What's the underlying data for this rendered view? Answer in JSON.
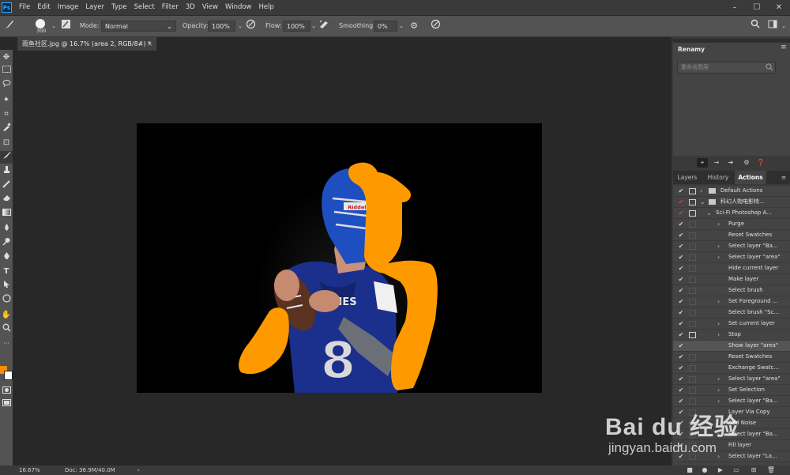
{
  "menubar": {
    "logo": "Ps",
    "items": [
      "File",
      "Edit",
      "Image",
      "Layer",
      "Type",
      "Select",
      "Filter",
      "3D",
      "View",
      "Window",
      "Help"
    ],
    "window_buttons": [
      "–",
      "☐",
      "✕"
    ]
  },
  "options": {
    "brush_size": "300",
    "mode_label": "Mode:",
    "mode_value": "Normal",
    "opacity_label": "Opacity:",
    "opacity_value": "100%",
    "flow_label": "Flow:",
    "flow_value": "100%",
    "smoothing_label": "Smoothing:",
    "smoothing_value": "0%"
  },
  "document": {
    "tab_title": "雨鱼社区.jpg @ 16.7% (area 2, RGB/8#) *",
    "tab_close": "×"
  },
  "status": {
    "zoom": "16.67%",
    "doc": "Doc: 36.9M/40.0M",
    "arrow": "›"
  },
  "colors": {
    "foreground": "#ff8c00",
    "background": "#ffffff",
    "paint": "#ff9900"
  },
  "renamy": {
    "title": "Renamy",
    "search_placeholder": "重命名图层"
  },
  "panel_tabs": {
    "layers": "Layers",
    "history": "History",
    "actions": "Actions"
  },
  "actions": [
    {
      "label": "Default Actions",
      "level": 0,
      "check": "✔",
      "red": false,
      "folder": true,
      "arrow": "›"
    },
    {
      "label": "科幻人物电影特...",
      "level": 0,
      "check": "✔",
      "red": true,
      "folder": true,
      "arrow": "⌄"
    },
    {
      "label": "Sci-Fi Photoshop A...",
      "level": 1,
      "check": "✔",
      "red": true,
      "folder": false,
      "arrow": "⌄"
    },
    {
      "label": "Purge",
      "level": 2,
      "check": "✔",
      "red": false,
      "folder": false,
      "arrow": "›"
    },
    {
      "label": "Reset Swatches",
      "level": 2,
      "check": "✔",
      "red": false,
      "folder": false,
      "arrow": ""
    },
    {
      "label": "Select layer \"Ba...",
      "level": 2,
      "check": "✔",
      "red": false,
      "folder": false,
      "arrow": "›"
    },
    {
      "label": "Select layer \"area\"",
      "level": 2,
      "check": "✔",
      "red": false,
      "folder": false,
      "arrow": "›"
    },
    {
      "label": "Hide current layer",
      "level": 2,
      "check": "✔",
      "red": false,
      "folder": false,
      "arrow": ""
    },
    {
      "label": "Make layer",
      "level": 2,
      "check": "✔",
      "red": false,
      "folder": false,
      "arrow": ""
    },
    {
      "label": "Select brush",
      "level": 2,
      "check": "✔",
      "red": false,
      "folder": false,
      "arrow": ""
    },
    {
      "label": "Set Foreground ...",
      "level": 2,
      "check": "✔",
      "red": false,
      "folder": false,
      "arrow": "›"
    },
    {
      "label": "Select brush \"Sc...",
      "level": 2,
      "check": "✔",
      "red": false,
      "folder": false,
      "arrow": ""
    },
    {
      "label": "Set current layer",
      "level": 2,
      "check": "✔",
      "red": false,
      "folder": false,
      "arrow": "›"
    },
    {
      "label": "Stop",
      "level": 2,
      "check": "✔",
      "red": false,
      "folder": false,
      "arrow": "›"
    },
    {
      "label": "Show layer \"area\"",
      "level": 2,
      "check": "✔",
      "red": false,
      "folder": false,
      "arrow": "",
      "selected": true
    },
    {
      "label": "Reset Swatches",
      "level": 2,
      "check": "✔",
      "red": false,
      "folder": false,
      "arrow": ""
    },
    {
      "label": "Exchange Swatc...",
      "level": 2,
      "check": "✔",
      "red": false,
      "folder": false,
      "arrow": ""
    },
    {
      "label": "Select layer \"area\"",
      "level": 2,
      "check": "✔",
      "red": false,
      "folder": false,
      "arrow": "›"
    },
    {
      "label": "Set Selection",
      "level": 2,
      "check": "✔",
      "red": false,
      "folder": false,
      "arrow": "›"
    },
    {
      "label": "Select layer \"Ba...",
      "level": 2,
      "check": "✔",
      "red": false,
      "folder": false,
      "arrow": "›"
    },
    {
      "label": "Layer Via Copy",
      "level": 2,
      "check": "✔",
      "red": false,
      "folder": false,
      "arrow": ""
    },
    {
      "label": "Add Noise",
      "level": 2,
      "check": "✔",
      "red": false,
      "folder": false,
      "arrow": ""
    },
    {
      "label": "Select layer \"Ba...",
      "level": 2,
      "check": "✔",
      "red": false,
      "folder": false,
      "arrow": "›"
    },
    {
      "label": "Fill layer",
      "level": 2,
      "check": "✔",
      "red": false,
      "folder": false,
      "arrow": ""
    },
    {
      "label": "Select layer \"La...",
      "level": 2,
      "check": "✔",
      "red": false,
      "folder": false,
      "arrow": "›"
    }
  ],
  "watermark": {
    "brand": "Bai du 经验",
    "url": "jingyan.baidu.com"
  },
  "image": {
    "jersey_text": "KIES",
    "jersey_number": "8",
    "helmet_brand": "Riddell"
  }
}
